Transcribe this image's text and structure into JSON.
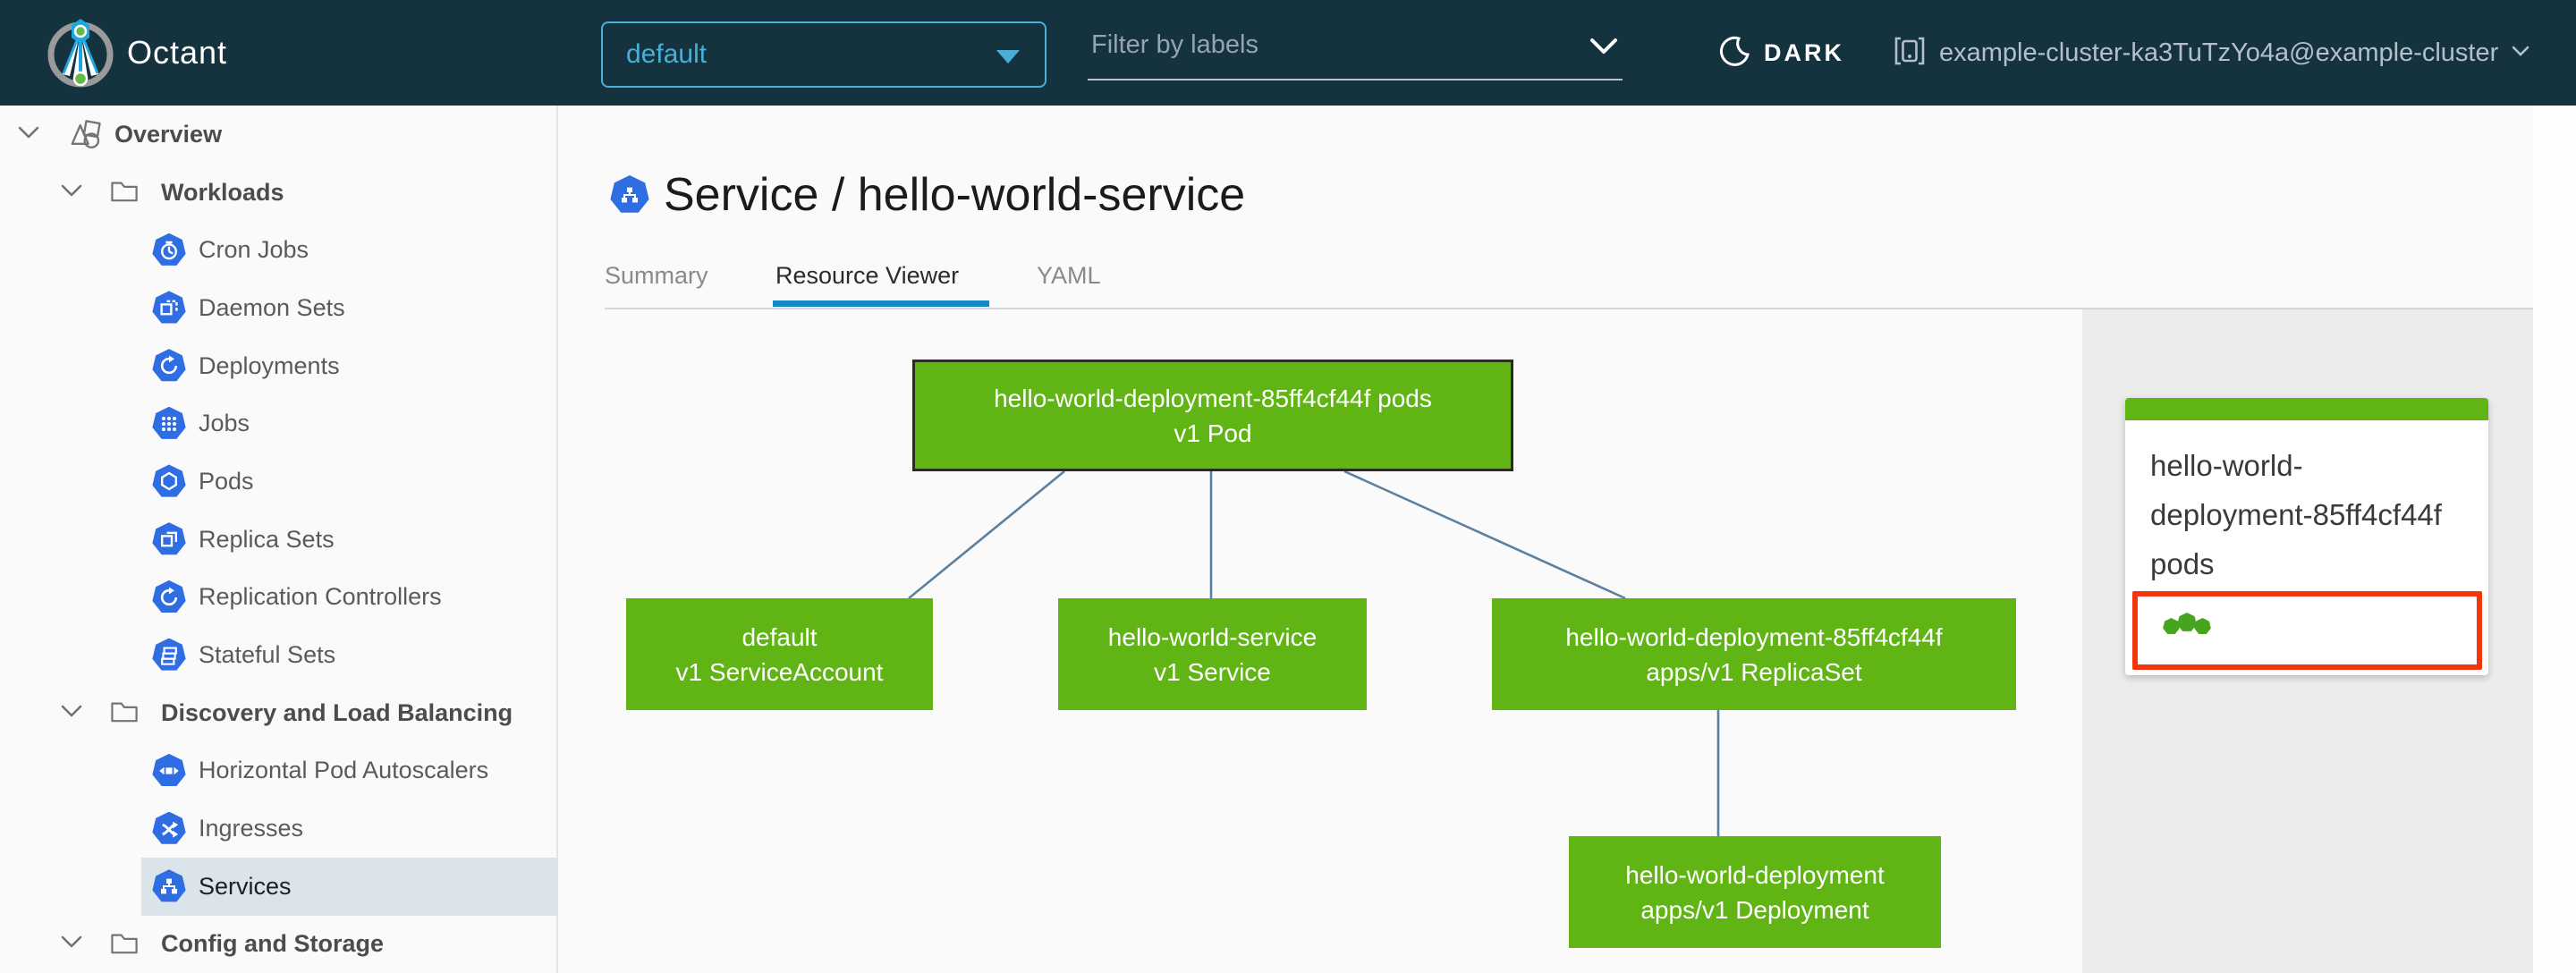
{
  "header": {
    "app_name": "Octant",
    "namespace_selector": {
      "value": "default"
    },
    "filter": {
      "placeholder": "Filter by labels"
    },
    "theme_toggle": {
      "label": "DARK"
    },
    "cluster_selector": {
      "label": "example-cluster-ka3TuTzYo4a@example-cluster"
    }
  },
  "sidebar": {
    "items": [
      {
        "label": "Overview",
        "level": 1,
        "type": "group",
        "icon": "objects-icon",
        "expanded": true
      },
      {
        "label": "Workloads",
        "level": 2,
        "type": "group",
        "icon": "folder-icon",
        "expanded": true
      },
      {
        "label": "Cron Jobs",
        "level": 3,
        "type": "item",
        "icon": "cronjob-heptagon-icon"
      },
      {
        "label": "Daemon Sets",
        "level": 3,
        "type": "item",
        "icon": "daemonset-heptagon-icon"
      },
      {
        "label": "Deployments",
        "level": 3,
        "type": "item",
        "icon": "deployment-heptagon-icon"
      },
      {
        "label": "Jobs",
        "level": 3,
        "type": "item",
        "icon": "job-heptagon-icon"
      },
      {
        "label": "Pods",
        "level": 3,
        "type": "item",
        "icon": "pod-heptagon-icon"
      },
      {
        "label": "Replica Sets",
        "level": 3,
        "type": "item",
        "icon": "replicaset-heptagon-icon"
      },
      {
        "label": "Replication Controllers",
        "level": 3,
        "type": "item",
        "icon": "replicationcontroller-heptagon-icon"
      },
      {
        "label": "Stateful Sets",
        "level": 3,
        "type": "item",
        "icon": "statefulset-heptagon-icon"
      },
      {
        "label": "Discovery and Load Balancing",
        "level": 2,
        "type": "group",
        "icon": "folder-icon",
        "expanded": true
      },
      {
        "label": "Horizontal Pod Autoscalers",
        "level": 3,
        "type": "item",
        "icon": "hpa-heptagon-icon"
      },
      {
        "label": "Ingresses",
        "level": 3,
        "type": "item",
        "icon": "ingress-heptagon-icon"
      },
      {
        "label": "Services",
        "level": 3,
        "type": "item",
        "icon": "service-heptagon-icon",
        "selected": true
      },
      {
        "label": "Config and Storage",
        "level": 2,
        "type": "group",
        "icon": "folder-icon",
        "expanded": true
      }
    ]
  },
  "main": {
    "title": {
      "icon": "service-heptagon-icon",
      "text": "Service / hello-world-service"
    },
    "tabs": [
      {
        "label": "Summary",
        "active": false
      },
      {
        "label": "Resource Viewer",
        "active": true
      },
      {
        "label": "YAML",
        "active": false
      }
    ]
  },
  "graph": {
    "nodes": [
      {
        "id": "pod",
        "name": "hello-world-deployment-85ff4cf44f pods",
        "kind": "v1 Pod",
        "status_color": "#60b515",
        "outlined": true
      },
      {
        "id": "serviceaccount",
        "name": "default",
        "kind": "v1 ServiceAccount",
        "status_color": "#60b515"
      },
      {
        "id": "service",
        "name": "hello-world-service",
        "kind": "v1 Service",
        "status_color": "#60b515"
      },
      {
        "id": "replicaset",
        "name": "hello-world-deployment-85ff4cf44f",
        "kind": "apps/v1 ReplicaSet",
        "status_color": "#60b515"
      },
      {
        "id": "deployment",
        "name": "hello-world-deployment",
        "kind": "apps/v1 Deployment",
        "status_color": "#60b515"
      }
    ],
    "edges": [
      {
        "from": "pod",
        "to": "serviceaccount"
      },
      {
        "from": "pod",
        "to": "service"
      },
      {
        "from": "pod",
        "to": "replicaset"
      },
      {
        "from": "replicaset",
        "to": "deployment"
      }
    ]
  },
  "detail_panel": {
    "selected_node_title": "hello-world-deployment-85ff4cf44f pods",
    "pod_status": {
      "ok_count": 3
    }
  },
  "colors": {
    "header_bg": "#15333f",
    "accent_blue": "#49afd9",
    "tab_underline": "#1588c9",
    "node_green": "#60b515",
    "selection_red": "#f5350d",
    "edge_blue": "#5d7f9e",
    "k8s_badge_blue": "#2f6de2",
    "selected_row_bg": "#dbe4ea",
    "panel_gray": "#ececec"
  }
}
